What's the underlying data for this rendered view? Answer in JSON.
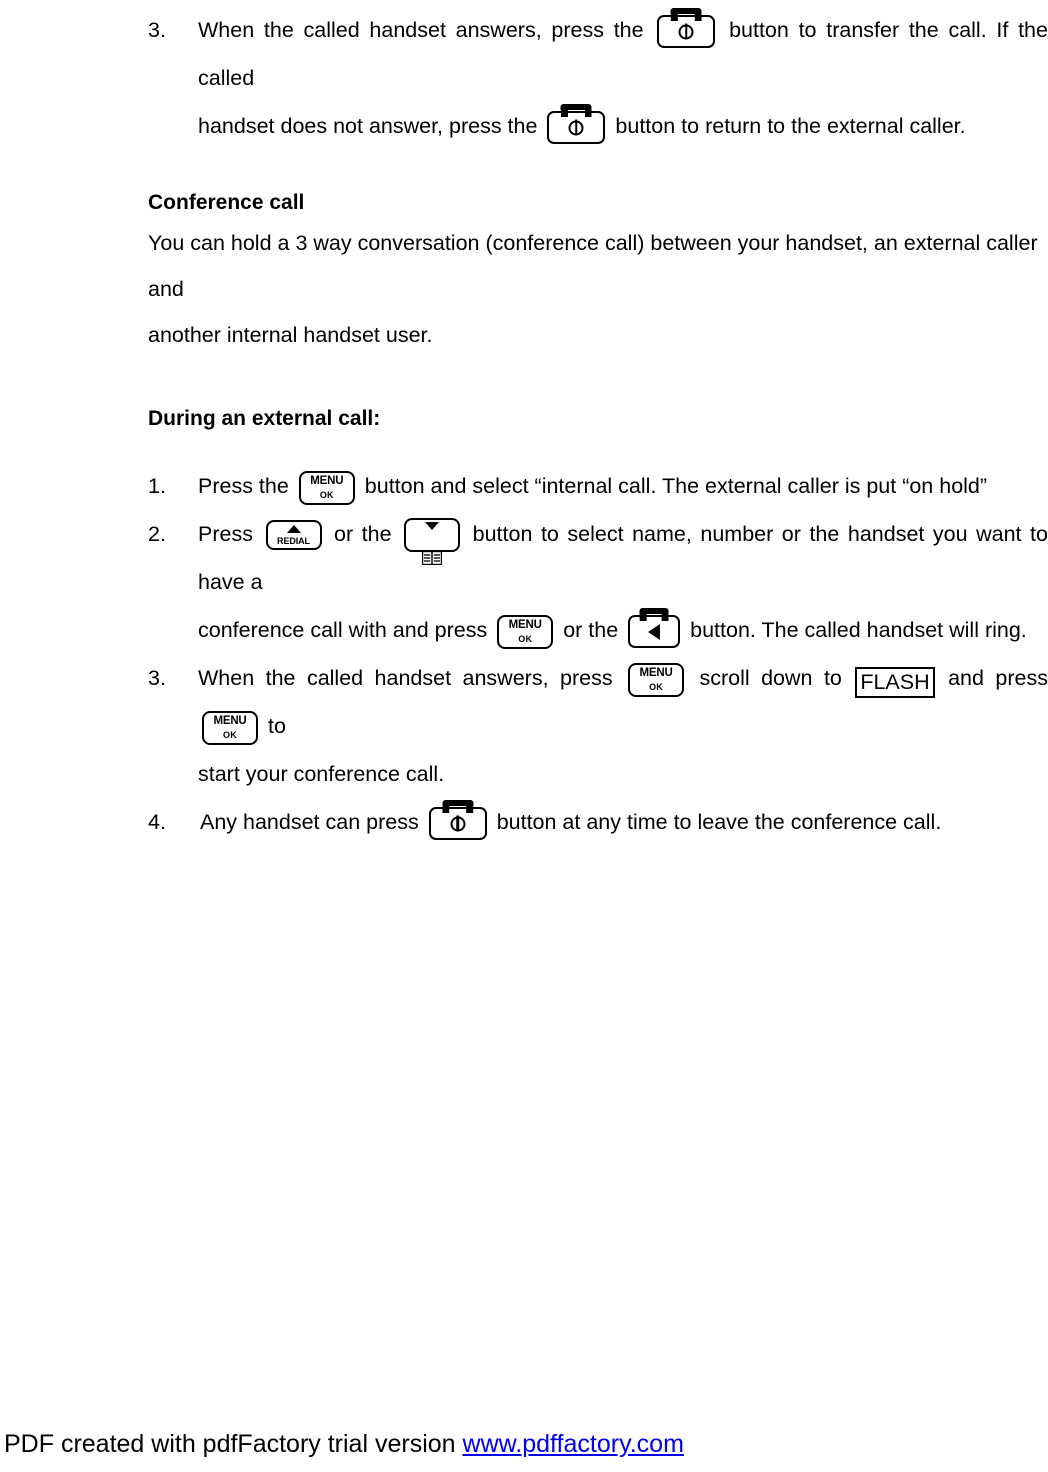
{
  "document": {
    "type": "user-manual-page",
    "language": "en"
  },
  "step3_transfer": {
    "marker": "3.",
    "text_before_key1": "When the called handset answers, press the",
    "key1": "talk-power-key",
    "text_after_key1": "button to transfer the call. If the called",
    "text_line2_before_key": "handset does not answer, press the",
    "key2": "talk-power-key",
    "text_line2_after_key": "button to return to the external caller."
  },
  "conference": {
    "heading": "Conference call",
    "body_line1": "You can hold a 3 way conversation (conference call) between your handset, an external caller and",
    "body_line2": "another internal handset user."
  },
  "during_call": {
    "heading": "During an external call:",
    "steps": [
      {
        "marker": "1.",
        "before": "Press the",
        "key": "menu-ok-key",
        "after": "button and select “internal call. The external caller is put “on hold”"
      },
      {
        "marker": "2.",
        "before": "Press",
        "key1": "redial-up-key",
        "mid1": "or the",
        "key2": "phonebook-down-key",
        "mid2": "button to select name, number or the handset you want to have a",
        "line2_before": "conference call with and press",
        "key3": "menu-ok-key",
        "line2_mid": "or the",
        "key4": "talk-speaker-key",
        "line2_after": "button. The called handset will ring."
      },
      {
        "marker": "3.",
        "before": "When the called handset answers, press",
        "key1": "menu-ok-key",
        "mid1": "scroll down to",
        "boxed_label": "FLASH",
        "mid2": "and press",
        "key2": "menu-ok-key",
        "after": "to",
        "line2": "start your conference call."
      },
      {
        "marker": "4.",
        "before": "Any handset can press",
        "key": "talk-power-key",
        "after": "button at any time to leave the conference call."
      }
    ]
  },
  "keys": {
    "menu": {
      "line1": "MENU",
      "line2": "OK"
    },
    "redial": {
      "label": "REDIAL"
    }
  },
  "footer": {
    "text": "PDF created with pdfFactory trial version",
    "link": "www.pdffactory.com",
    "link_color": "#0000ee"
  }
}
